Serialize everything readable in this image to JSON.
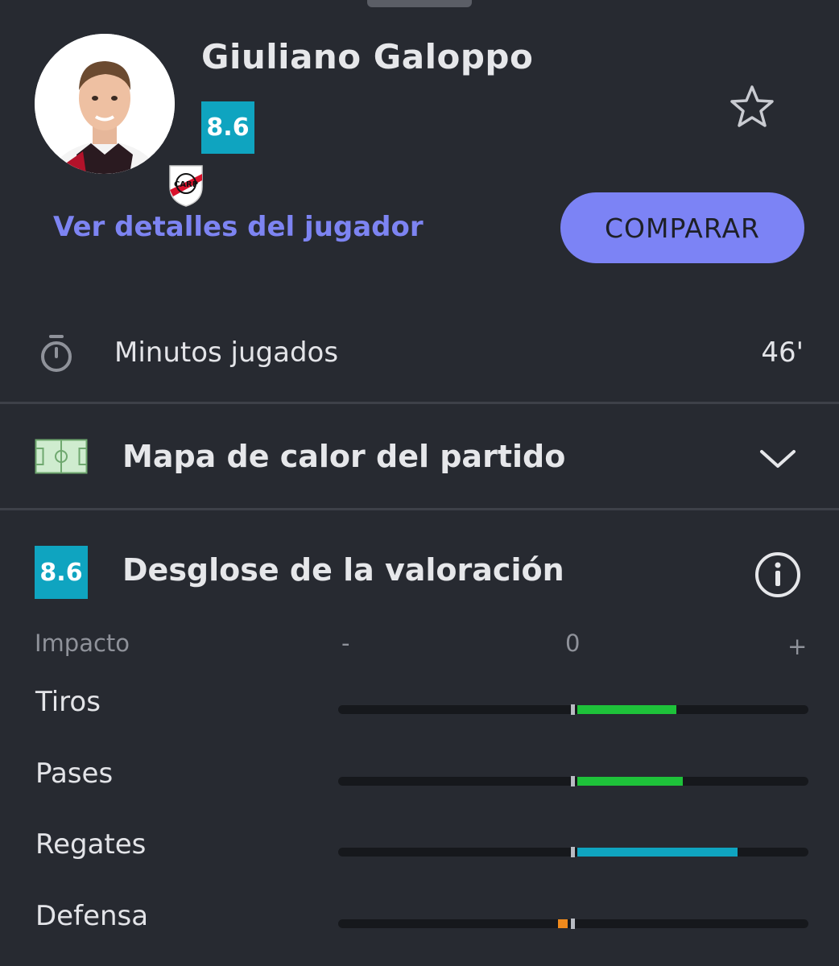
{
  "player": {
    "name": "Giuliano Galoppo",
    "rating": "8.6",
    "details_link": "Ver detalles del jugador",
    "compare_label": "COMPARAR",
    "club_badge_text": "CARP"
  },
  "minutes": {
    "label": "Minutos jugados",
    "value": "46'"
  },
  "heatmap": {
    "title": "Mapa de calor del partido"
  },
  "breakdown": {
    "rating": "8.6",
    "title": "Desglose de la valoración",
    "impact_label": "Impacto",
    "axis_minus": "-",
    "axis_zero": "0",
    "axis_plus": "+",
    "stats": [
      {
        "label": "Tiros",
        "impact": 0.42,
        "color": "#1ec23a"
      },
      {
        "label": "Pases",
        "impact": 0.45,
        "color": "#1ec23a"
      },
      {
        "label": "Regates",
        "impact": 0.68,
        "color": "#0fa4c0"
      },
      {
        "label": "Defensa",
        "impact": -0.04,
        "color": "#f08a1c"
      }
    ]
  },
  "colors": {
    "accent": "#7c83f5",
    "rating_bg": "#0fa4c0",
    "background": "#272a31"
  }
}
